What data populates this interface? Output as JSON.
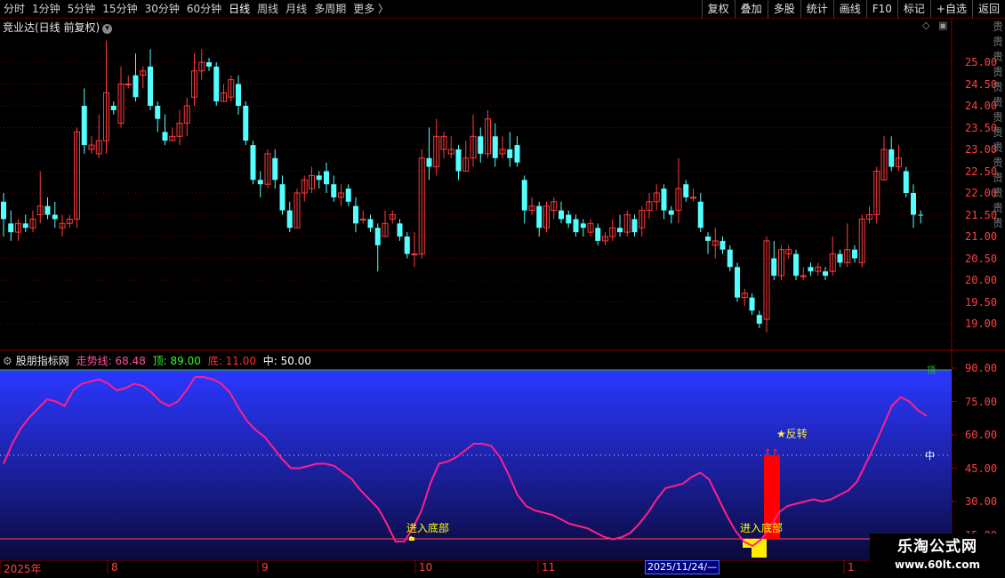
{
  "toolbar": {
    "periods": [
      "分时",
      "1分钟",
      "5分钟",
      "15分钟",
      "30分钟",
      "60分钟",
      "日线",
      "周线",
      "月线",
      "多周期",
      "更多 〉"
    ],
    "active": "日线",
    "buttons": [
      "复权",
      "叠加",
      "多股",
      "统计",
      "画线",
      "F10",
      "标记",
      "+自选",
      "返回"
    ]
  },
  "main_chart": {
    "title": "竞业达(日线 前复权)",
    "y_ticks": [
      "25.00",
      "24.50",
      "24.00",
      "23.50",
      "23.00",
      "22.50",
      "22.00",
      "21.50",
      "21.00",
      "20.50",
      "20.00",
      "19.50",
      "19.00"
    ],
    "side_text": "贵贵贵贵贵贵贵贵贵贵贵贵贵贵",
    "colors": {
      "up": "#ff3a3a",
      "down": "#54ffff",
      "bg": "#000000",
      "grid": "#7a0000"
    }
  },
  "indicator": {
    "name": "股朋指标网",
    "trend_label": "走势线:",
    "trend_value": "68.48",
    "top_label": "顶:",
    "top_value": "89.00",
    "bottom_label": "底:",
    "bottom_value": "11.00",
    "mid_label": "中:",
    "mid_value": "50.00",
    "y_ticks": [
      "90.00",
      "75.00",
      "60.00",
      "45.00",
      "30.00",
      "15.00"
    ],
    "mid_marker": "中",
    "top_marker": "顶",
    "annotations": {
      "bottom1": "进入底部",
      "bottom2": "进入底部",
      "reversal": "★反转"
    },
    "colors": {
      "line": "#ff1f8a",
      "signal": "#ff0000",
      "yellow": "#ffff00",
      "reversal": "#ffee33"
    }
  },
  "dates": {
    "labels": [
      "2025年",
      "8",
      "9",
      "10",
      "11",
      "1"
    ],
    "current": "2025/11/24/—"
  },
  "watermark": {
    "title": "乐淘公式网",
    "url": "www.60lt.com"
  }
}
